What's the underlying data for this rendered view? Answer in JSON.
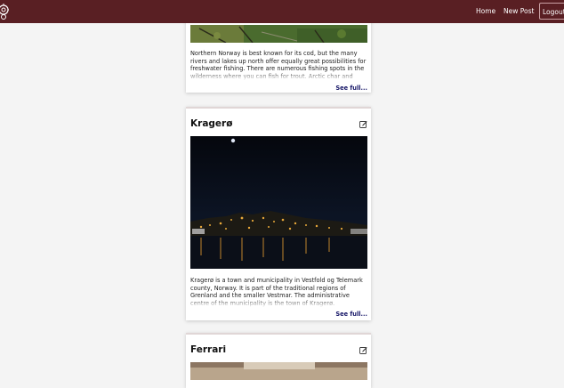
{
  "nav": {
    "home": "Home",
    "new_post": "New Post",
    "logout": "Logout"
  },
  "posts": [
    {
      "title": "",
      "text": "Northern Norway is best known for its cod, but the many rivers and lakes up north offer equally great possibilities for freshwater fishing. There are numerous fishing spots in the wilderness where you can fish for trout. Arctic char and salmon in peace.",
      "see_full": "See full..."
    },
    {
      "title": "Kragerø",
      "text": "Kragerø is a town and municipality in Vestfold og Telemark county, Norway. It is part of the traditional regions of Grenland and the smaller Vestmar. The administrative centre of the municipality is the town of Kragerø.",
      "see_full": "See full..."
    },
    {
      "title": "Ferrari"
    }
  ],
  "colors": {
    "navbar": "#591f23",
    "page_background": "#f4f4f4",
    "link": "#141466"
  },
  "icons": {
    "logo": "gear-logo-icon",
    "edit": "edit-icon"
  }
}
